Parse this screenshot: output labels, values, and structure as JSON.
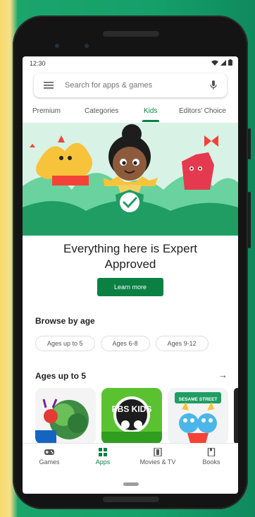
{
  "status_bar": {
    "time": "12:30"
  },
  "search": {
    "placeholder": "Search for apps & games"
  },
  "tabs": [
    {
      "label": "Premium"
    },
    {
      "label": "Categories"
    },
    {
      "label": "Kids"
    },
    {
      "label": "Editors' Choice"
    }
  ],
  "active_tab": "Kids",
  "banner": {
    "heading_line1": "Everything here is Expert",
    "heading_line2": "Approved",
    "button_label": "Learn more"
  },
  "browse": {
    "title": "Browse by age",
    "chips": [
      "Ages up to 5",
      "Ages 6-8",
      "Ages 9-12"
    ]
  },
  "section": {
    "title": "Ages up to 5"
  },
  "apps": [
    {
      "icon": "caterpillar-app-icon"
    },
    {
      "icon": "pbs-kids-app-icon",
      "logo_text": "PBS KIDS"
    },
    {
      "icon": "sesame-street-app-icon",
      "logo_text": "SESAME STREET"
    }
  ],
  "bottom_nav": [
    {
      "label": "Games",
      "icon": "gamepad-icon"
    },
    {
      "label": "Apps",
      "icon": "apps-grid-icon"
    },
    {
      "label": "Movies & TV",
      "icon": "film-icon"
    },
    {
      "label": "Books",
      "icon": "book-icon"
    }
  ],
  "active_nav": "Apps",
  "colors": {
    "accent": "#0b8043",
    "banner_bg": "#d8f2e6",
    "background": "#1aa56b"
  }
}
